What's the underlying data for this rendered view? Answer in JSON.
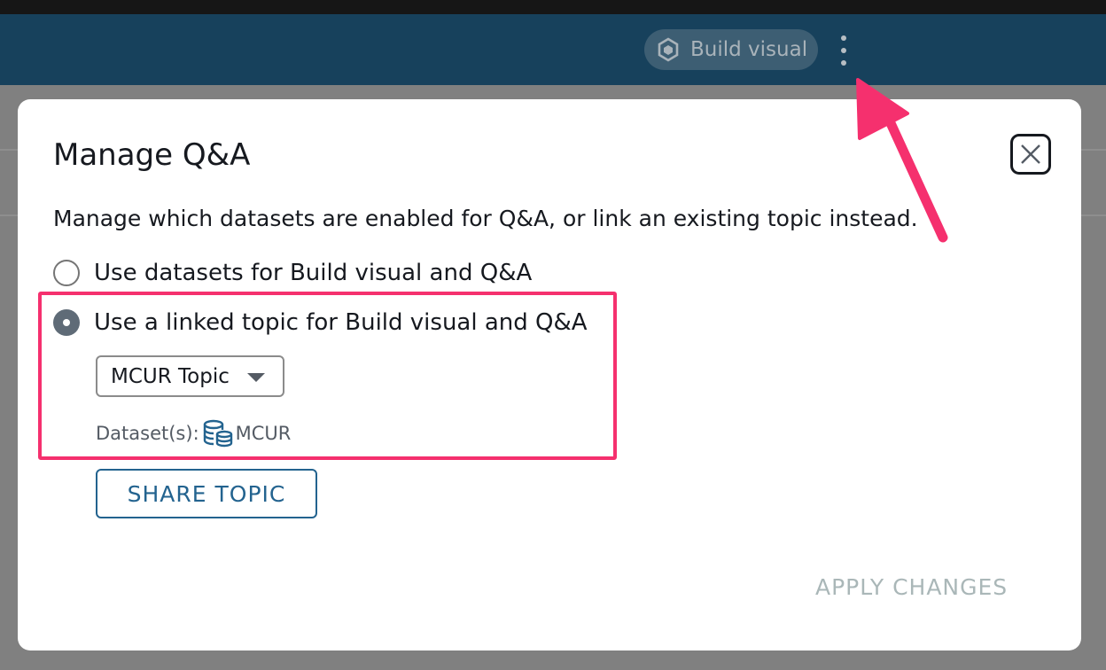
{
  "header": {
    "build_visual_label": "Build visual",
    "build_visual_icon": "hexagon-cube-icon",
    "more_menu_icon": "kebab-vertical-icon"
  },
  "modal": {
    "title": "Manage Q&A",
    "description": "Manage which datasets are enabled for Q&A, or link an existing topic instead.",
    "options": [
      {
        "label": "Use datasets for Build visual and Q&A",
        "selected": false
      },
      {
        "label": "Use a linked topic for Build visual and Q&A",
        "selected": true
      }
    ],
    "topic_select": {
      "value": "MCUR Topic"
    },
    "datasets_label": "Dataset(s):",
    "dataset_name": "MCUR",
    "share_topic_label": "SHARE TOPIC",
    "apply_changes_label": "APPLY CHANGES"
  },
  "annotation_colors": {
    "highlight": "#f5306e",
    "arrow": "#f5306e",
    "link_blue": "#23638f",
    "header_bg": "#17415c"
  }
}
